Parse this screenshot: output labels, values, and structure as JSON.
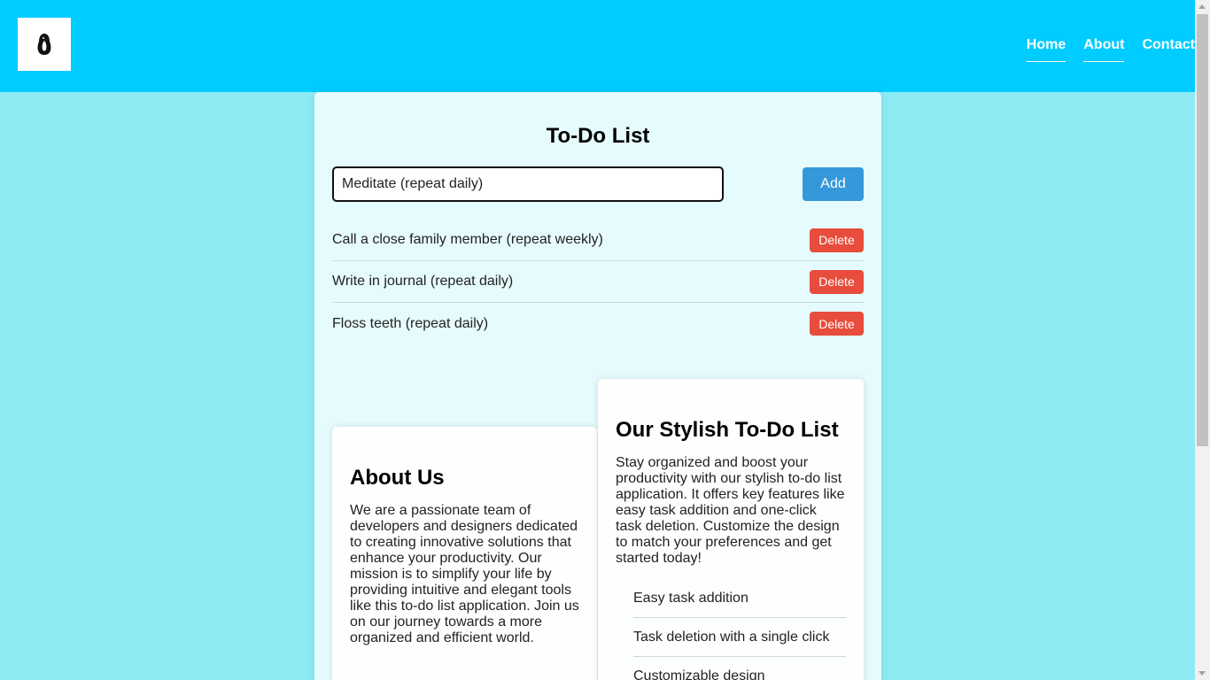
{
  "header": {
    "logo": "penguin-logo",
    "nav": [
      {
        "label": "Home"
      },
      {
        "label": "About"
      },
      {
        "label": "Contact"
      }
    ]
  },
  "todo": {
    "title": "To-Do List",
    "input_value": "Meditate (repeat daily)",
    "add_label": "Add",
    "delete_label": "Delete",
    "tasks": [
      "Call a close family member (repeat weekly)",
      "Write in journal (repeat daily)",
      "Floss teeth (repeat daily)"
    ]
  },
  "about": {
    "heading": "About Us",
    "body": "We are a passionate team of developers and designers dedicated to creating innovative solutions that enhance your productivity. Our mission is to simplify your life by providing intuitive and elegant tools like this to-do list application. Join us on our journey towards a more organized and efficient world."
  },
  "features": {
    "heading": "Our Stylish To-Do List",
    "body": "Stay organized and boost your productivity with our stylish to-do list application. It offers key features like easy task addition and one-click task deletion. Customize the design to match your preferences and get started today!",
    "items": [
      "Easy task addition",
      "Task deletion with a single click",
      "Customizable design"
    ]
  },
  "colors": {
    "header_bg": "#00ccff",
    "page_bg": "#8eebf4",
    "add_button": "#3498db",
    "delete_button": "#e74c3c"
  }
}
